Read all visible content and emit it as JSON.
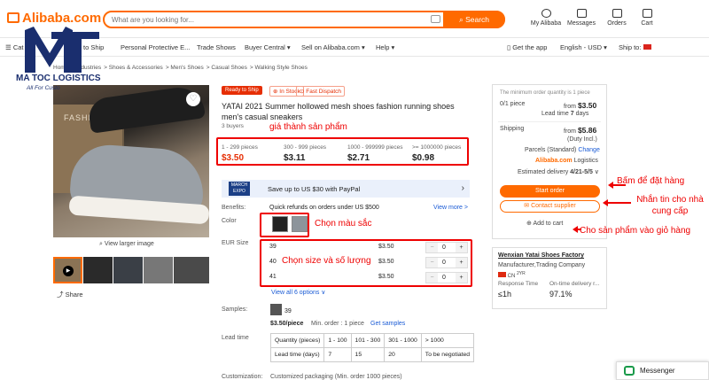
{
  "header": {
    "logo": "Alibaba.com",
    "search_placeholder": "What are you looking for...",
    "search_button": "Search",
    "icons": [
      {
        "label": "My Alibaba",
        "icon": "user-icon"
      },
      {
        "label": "Messages",
        "icon": "message-icon"
      },
      {
        "label": "Orders",
        "icon": "orders-icon"
      },
      {
        "label": "Cart",
        "icon": "cart-icon"
      }
    ]
  },
  "nav": {
    "items": [
      "Cat",
      "dy to Ship",
      "Personal Protective E...",
      "Trade Shows",
      "Buyer Central ▾",
      "Sell on Alibaba.com ▾",
      "Help ▾"
    ],
    "get_app": "Get the app",
    "language": "English - USD ▾",
    "ship_to": "Ship to:"
  },
  "breadcrumbs": [
    "Home",
    "Industries",
    "Shoes & Accessories",
    "Men's Shoes",
    "Casual Shoes",
    "Walking Style Shoes"
  ],
  "brand": {
    "name": "MA TOC LOGISTICS",
    "tagline": "All For Custo"
  },
  "gallery": {
    "box_text": "FASHION",
    "view_larger": "View larger image",
    "share": "Share"
  },
  "product": {
    "badge": "Ready to Ship",
    "in_stock": "In Stock",
    "fast_dispatch": "Fast Dispatch",
    "title": "YATAI 2021 Summer hollowed mesh shoes fashion running shoes men's casual sneakers",
    "buyers": "3 buyers",
    "tiers": [
      {
        "qty": "1 - 299 pieces",
        "price": "$3.50"
      },
      {
        "qty": "300 - 999 pieces",
        "price": "$3.11"
      },
      {
        "qty": "1000 - 999999 pieces",
        "price": "$2.71"
      },
      {
        "qty": ">= 1000000 pieces",
        "price": "$0.98"
      }
    ],
    "paypal_badge": "MARCH EXPO",
    "paypal_text": "Save up to US $30 with PayPal",
    "benefits_label": "Benefits:",
    "benefits_text": "Quick refunds on orders under US $500",
    "view_more": "View more >",
    "color_label": "Color",
    "size_label": "EUR Size",
    "sizes": [
      {
        "size": "39",
        "price": "$3.50",
        "qty": "0"
      },
      {
        "size": "40",
        "price": "$3.50",
        "qty": "0"
      },
      {
        "size": "41",
        "price": "$3.50",
        "qty": "0"
      }
    ],
    "view_all": "View all 6 options ∨",
    "samples_label": "Samples:",
    "samples_count": "39",
    "sample_price": "$3.50/piece",
    "min_order": "Min. order : 1 piece",
    "get_samples": "Get samples",
    "lead_label": "Lead time",
    "lead_table": [
      [
        "Quantity (pieces)",
        "1 - 100",
        "101 - 300",
        "301 - 1000",
        "> 1000"
      ],
      [
        "Lead time (days)",
        "7",
        "15",
        "20",
        "To be negotiated"
      ]
    ],
    "customization_label": "Customization:",
    "customization_text": "Customized packaging (Min. order 1000 pieces)"
  },
  "order_panel": {
    "moq_note": "The minimum order quantity is 1 piece",
    "pieces": "0/1 piece",
    "from_label": "from",
    "from_price": "$3.50",
    "lead_time_label": "Lead time",
    "lead_time_value": "7",
    "lead_time_unit": "days",
    "shipping_label": "Shipping",
    "ship_from": "from",
    "ship_price": "$5.86",
    "duty": "(Duty Incl.)",
    "parcels": "Parcels (Standard)",
    "change": "Change",
    "logistics_brand": "Alibaba.com",
    "logistics_word": "Logistics",
    "est_delivery_label": "Estimated delivery",
    "est_delivery_value": "4/21-5/5",
    "start_order": "Start order",
    "contact_supplier": "Contact supplier",
    "add_to_cart": "Add to cart"
  },
  "supplier": {
    "name": "Wenxian Yatai Shoes Factory",
    "type": "Manufacturer,Trading Company",
    "country": "CN",
    "years": "2YR",
    "response_label": "Response Time",
    "response_value": "≤1h",
    "ontime_label": "On-time delivery r...",
    "ontime_value": "97.1%"
  },
  "annotations": {
    "price": "giá thành sản phẩm",
    "color": "Chọn màu sắc",
    "size": "Chọn size và số lượng",
    "order": "Bấm để đặt hàng",
    "contact": "Nhắn tin cho nhà cung cấp",
    "cart": "Cho sản phẩm vào giỏ hàng"
  },
  "messenger": "Messenger",
  "colors": {
    "accent": "#ff6a00",
    "annotation": "#ee0000",
    "brand_navy": "#1a2e6e",
    "link": "#1a5bd5"
  }
}
